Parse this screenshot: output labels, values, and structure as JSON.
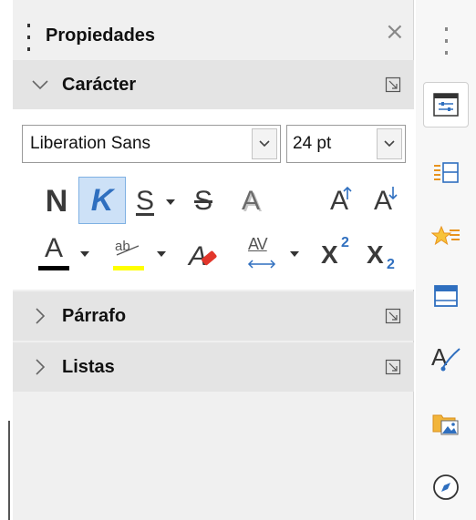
{
  "panel": {
    "title": "Propiedades",
    "close_glyph": "×"
  },
  "sections": {
    "caracter": {
      "label": "Carácter",
      "expanded": true
    },
    "parrafo": {
      "label": "Párrafo",
      "expanded": false
    },
    "listas": {
      "label": "Listas",
      "expanded": false
    }
  },
  "character": {
    "font_name": "Liberation Sans",
    "font_size": "24 pt",
    "bold_glyph": "N",
    "italic_glyph": "K",
    "underline_glyph": "S",
    "strike_glyph": "S",
    "shadow_glyph": "A",
    "grow_glyph": "A",
    "shrink_glyph": "A",
    "font_color_glyph": "A",
    "highlight_glyph": "ab",
    "spacing_glyph": "AV",
    "superscript_glyph": "X",
    "superscript_mark": "2",
    "subscript_glyph": "X",
    "subscript_mark": "2",
    "italic_active": true,
    "font_color": "#000000",
    "highlight_color": "#ffff00"
  },
  "sidebar": {
    "items": [
      {
        "name": "properties-icon",
        "active": true
      },
      {
        "name": "styles-icon",
        "active": false
      },
      {
        "name": "gallery-icon",
        "active": false
      },
      {
        "name": "navigator-panel-icon",
        "active": false
      },
      {
        "name": "style-inspector-icon",
        "active": false
      },
      {
        "name": "image-folder-icon",
        "active": false
      },
      {
        "name": "navigator-compass-icon",
        "active": false
      }
    ]
  },
  "colors": {
    "accent": "#2f6fbf",
    "active_bg": "#cde1f7",
    "panel_bg": "#f0f0f0",
    "section_header_bg": "#e4e4e4"
  }
}
